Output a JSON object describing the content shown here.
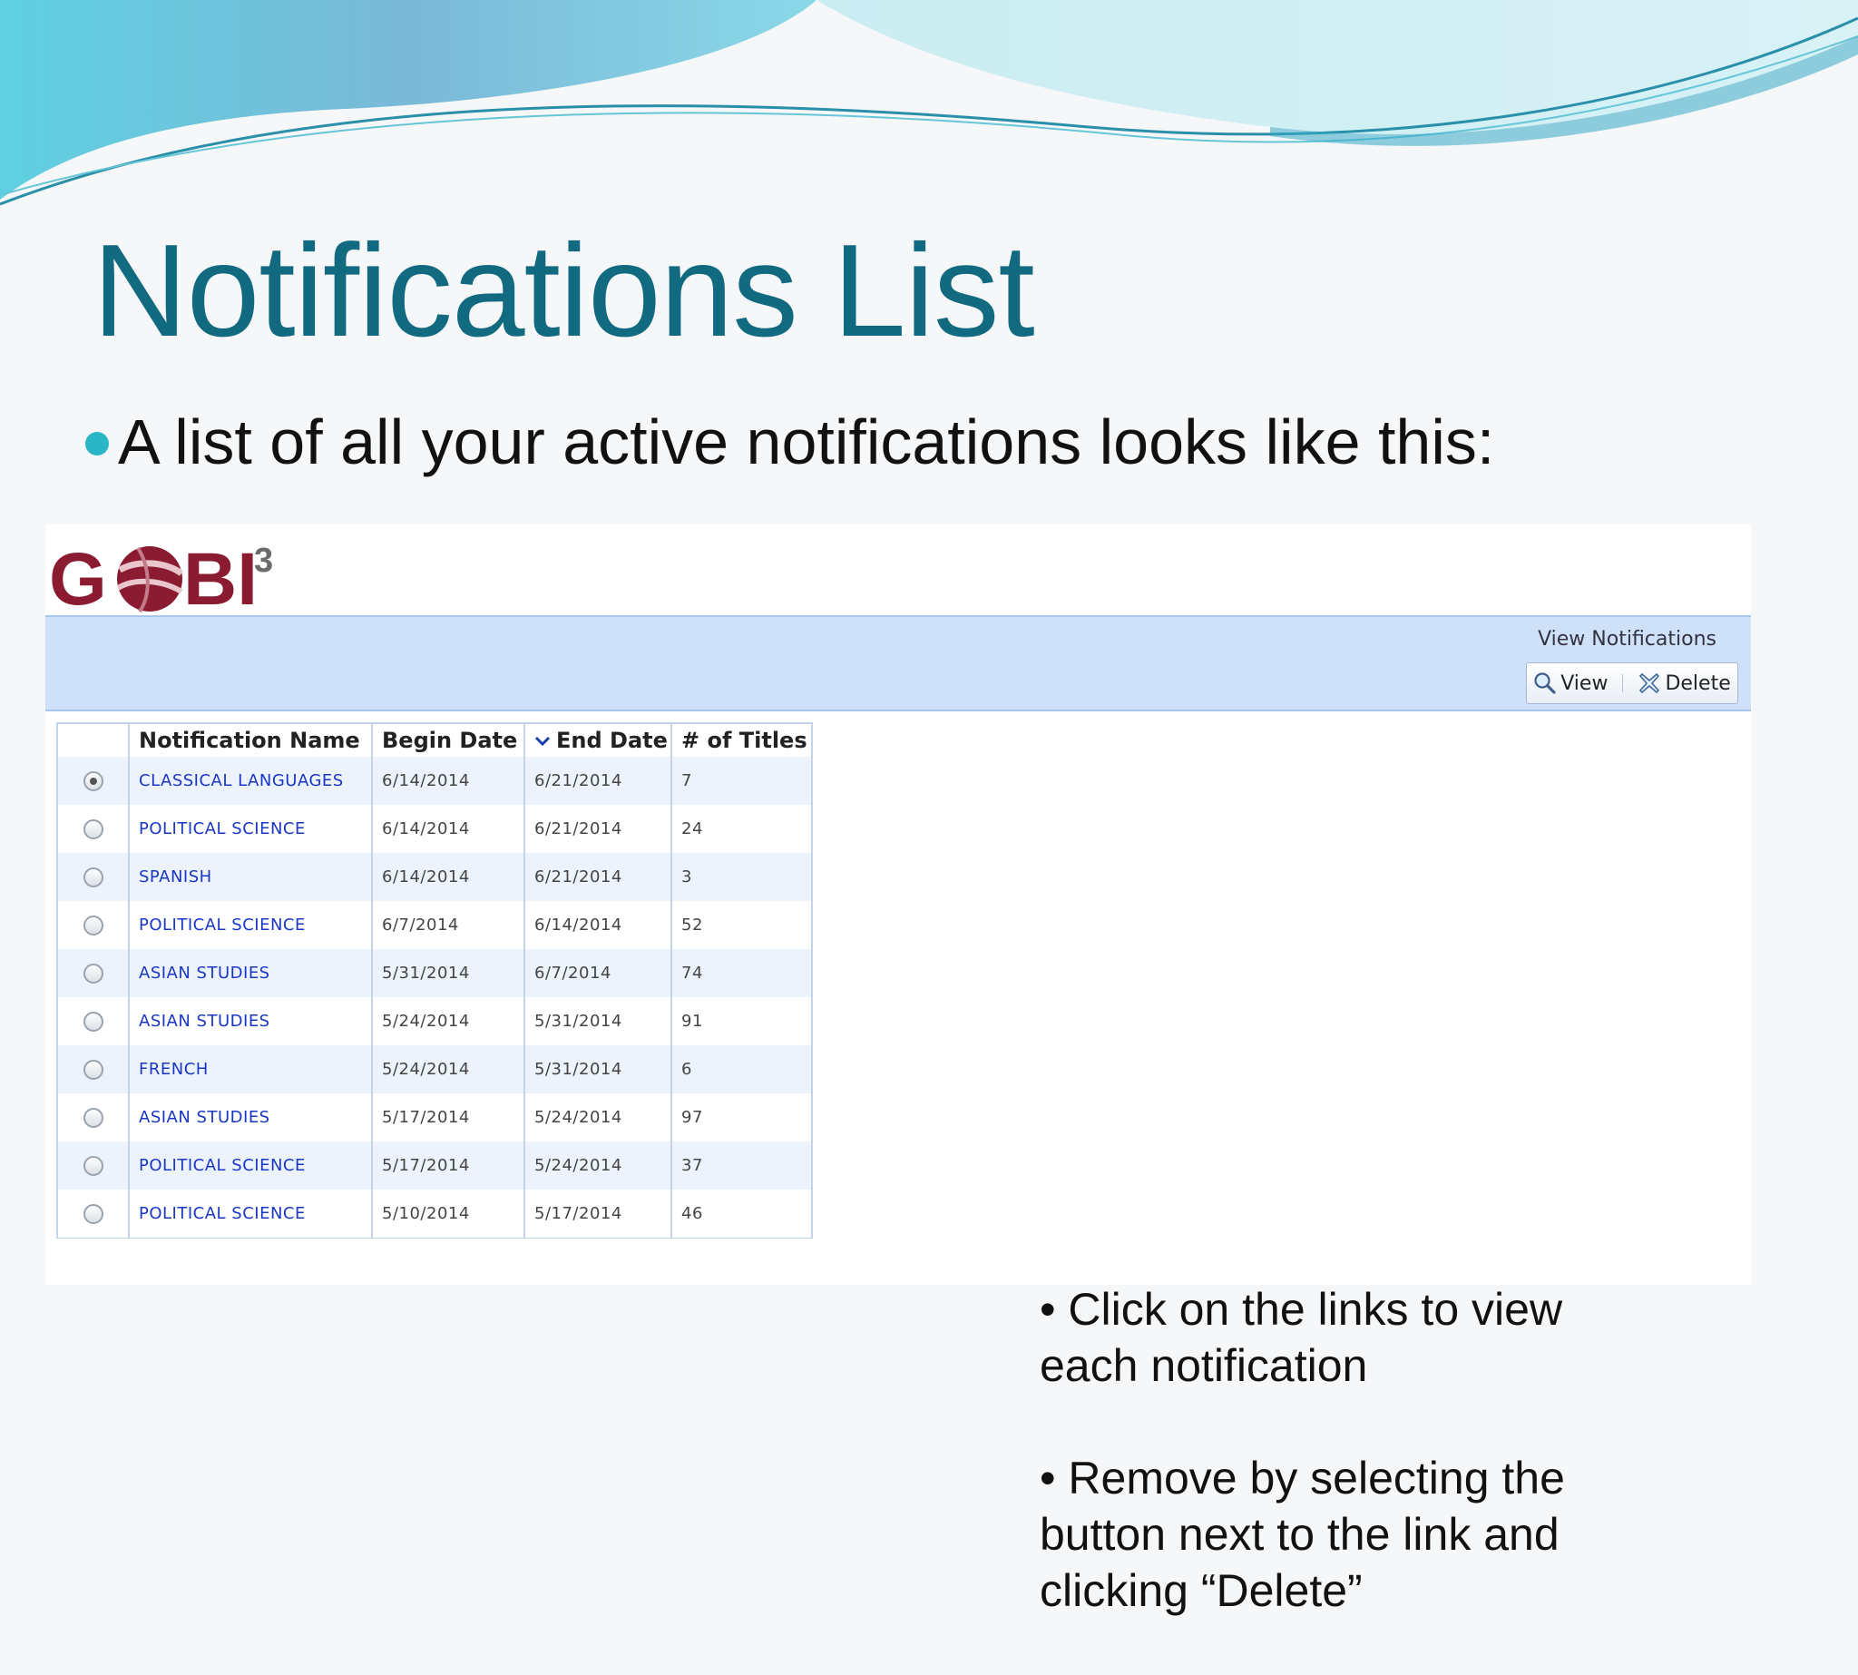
{
  "slide": {
    "title": "Notifications List",
    "bullet": "A list of all your active notifications looks like this:"
  },
  "app": {
    "logo": "GOBI3",
    "page_heading": "View Notifications",
    "toolbar": {
      "view_label": "View",
      "delete_label": "Delete"
    }
  },
  "table": {
    "headers": [
      "Notification Name",
      "Begin Date",
      "End Date",
      "# of Titles"
    ],
    "sorted_column": "End Date",
    "rows": [
      {
        "selected": true,
        "name": "CLASSICAL LANGUAGES",
        "begin": "6/14/2014",
        "end": "6/21/2014",
        "titles": "7"
      },
      {
        "selected": false,
        "name": "POLITICAL SCIENCE",
        "begin": "6/14/2014",
        "end": "6/21/2014",
        "titles": "24"
      },
      {
        "selected": false,
        "name": "SPANISH",
        "begin": "6/14/2014",
        "end": "6/21/2014",
        "titles": "3"
      },
      {
        "selected": false,
        "name": "POLITICAL SCIENCE",
        "begin": "6/7/2014",
        "end": "6/14/2014",
        "titles": "52"
      },
      {
        "selected": false,
        "name": "ASIAN STUDIES",
        "begin": "5/31/2014",
        "end": "6/7/2014",
        "titles": "74"
      },
      {
        "selected": false,
        "name": "ASIAN STUDIES",
        "begin": "5/24/2014",
        "end": "5/31/2014",
        "titles": "91"
      },
      {
        "selected": false,
        "name": "FRENCH",
        "begin": "5/24/2014",
        "end": "5/31/2014",
        "titles": "6"
      },
      {
        "selected": false,
        "name": "ASIAN STUDIES",
        "begin": "5/17/2014",
        "end": "5/24/2014",
        "titles": "97"
      },
      {
        "selected": false,
        "name": "POLITICAL SCIENCE",
        "begin": "5/17/2014",
        "end": "5/24/2014",
        "titles": "37"
      },
      {
        "selected": false,
        "name": "POLITICAL SCIENCE",
        "begin": "5/10/2014",
        "end": "5/17/2014",
        "titles": "46"
      }
    ]
  },
  "callout": {
    "line1": "• Click on the links to view each notification",
    "line2": "• Remove by selecting the button next to the link and clicking “Delete”"
  },
  "colors": {
    "title": "#126a80",
    "bullet_accent": "#29b6c7",
    "logo": "#8a1b30",
    "link": "#1a37c4",
    "band": "#cfe1f8"
  },
  "icons": [
    "wave-decoration",
    "bullet-dot",
    "gobi-logo",
    "magnifier-icon",
    "delete-x-icon",
    "sort-chevron-icon",
    "radio-button"
  ]
}
